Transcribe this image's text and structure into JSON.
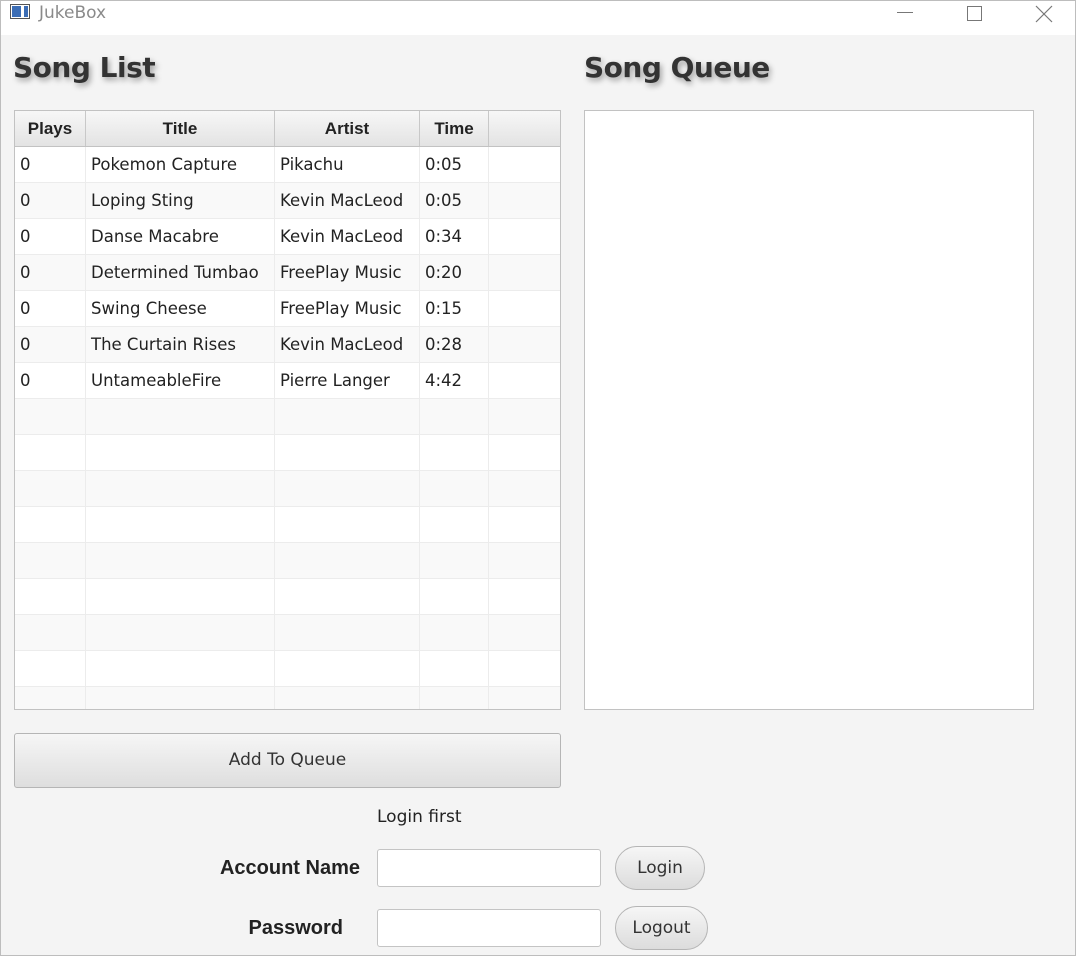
{
  "window": {
    "title": "JukeBox"
  },
  "headings": {
    "song_list": "Song List",
    "song_queue": "Song Queue"
  },
  "table": {
    "columns": [
      "Plays",
      "Title",
      "Artist",
      "Time",
      ""
    ],
    "rows": [
      {
        "plays": "0",
        "title": "Pokemon Capture",
        "artist": "Pikachu",
        "time": "0:05"
      },
      {
        "plays": "0",
        "title": "Loping Sting",
        "artist": "Kevin MacLeod",
        "time": "0:05"
      },
      {
        "plays": "0",
        "title": "Danse Macabre",
        "artist": "Kevin MacLeod",
        "time": "0:34"
      },
      {
        "plays": "0",
        "title": "Determined Tumbao",
        "artist": "FreePlay Music",
        "time": "0:20"
      },
      {
        "plays": "0",
        "title": "Swing Cheese",
        "artist": "FreePlay Music",
        "time": "0:15"
      },
      {
        "plays": "0",
        "title": "The Curtain Rises",
        "artist": "Kevin MacLeod",
        "time": "0:28"
      },
      {
        "plays": "0",
        "title": "UntameableFire",
        "artist": "Pierre Langer",
        "time": "4:42"
      }
    ]
  },
  "queue": {
    "items": []
  },
  "actions": {
    "add_to_queue": "Add To Queue"
  },
  "login": {
    "status": "Login first",
    "account_label": "Account Name",
    "password_label": "Password",
    "account_value": "",
    "password_value": "",
    "login_button": "Login",
    "logout_button": "Logout"
  }
}
